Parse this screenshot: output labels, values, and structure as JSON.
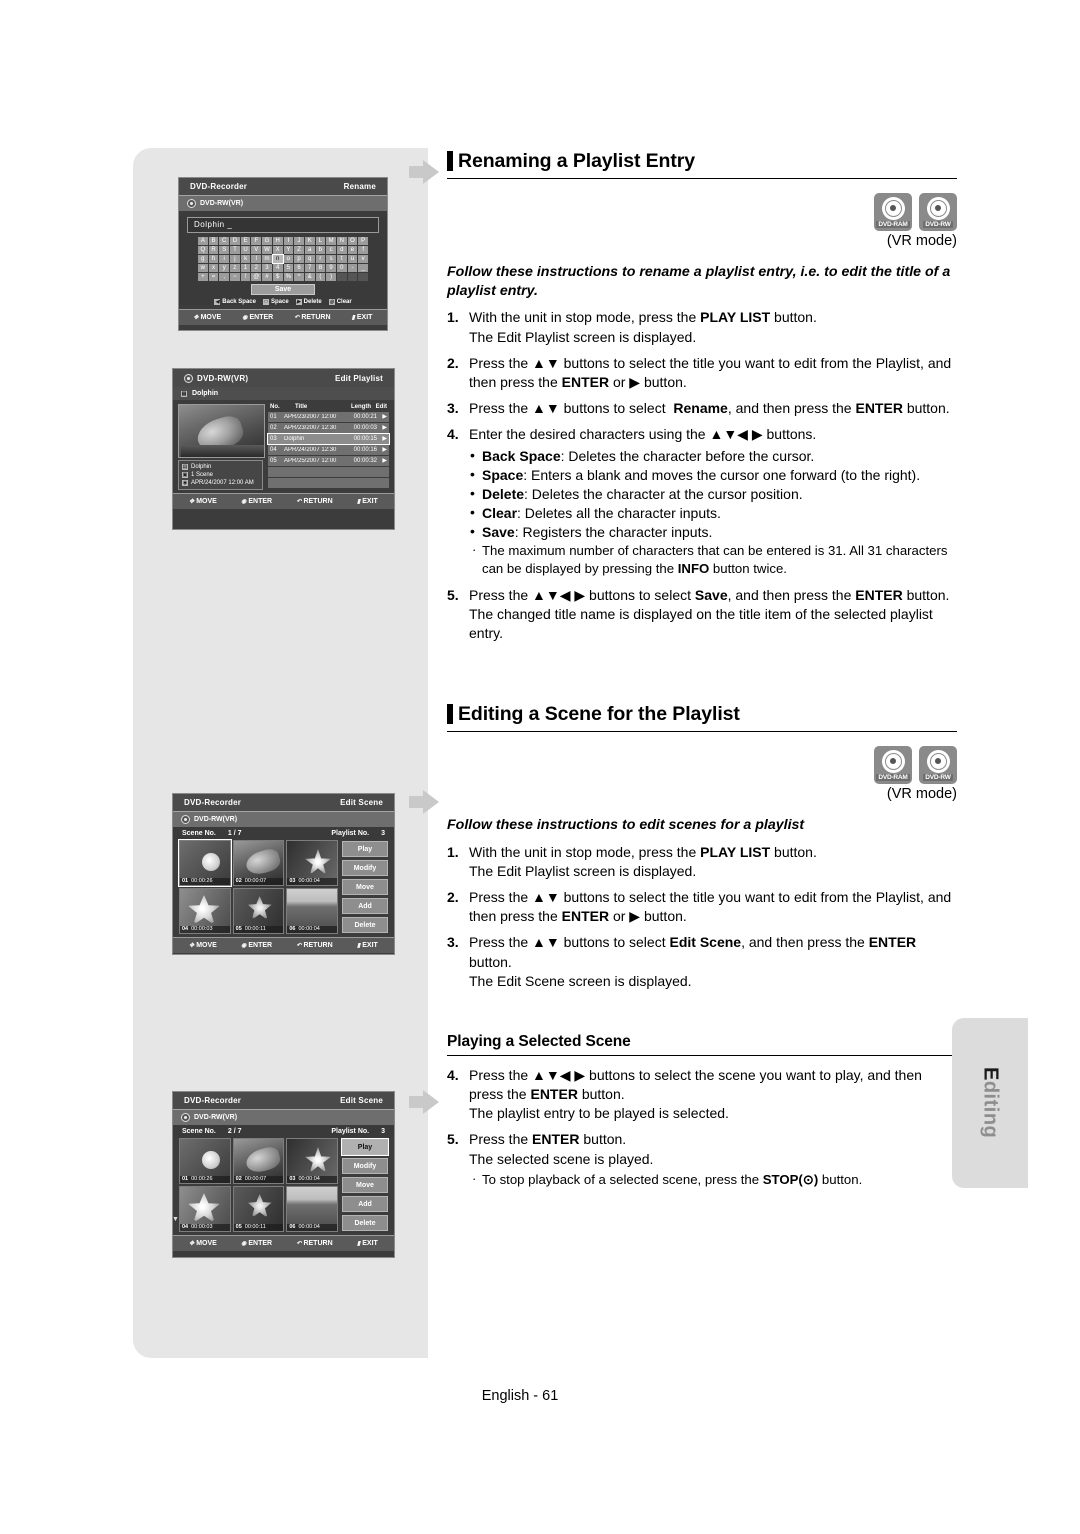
{
  "page": {
    "footer": "English - 61",
    "side_tab": "Editing"
  },
  "sections": [
    {
      "title": "Renaming a Playlist Entry",
      "mode_note": "(VR mode)",
      "disc_icons": [
        "DVD-RAM",
        "DVD-RW"
      ],
      "lead": "Follow these instructions to rename a playlist entry, i.e. to edit the title of a playlist entry.",
      "steps": [
        {
          "num": "1.",
          "text_html": "With the unit in stop mode, press the <b>PLAY LIST</b> button.<br>The Edit Playlist screen is displayed."
        },
        {
          "num": "2.",
          "text_html": "Press the ▲▼ buttons to select the title you want to edit from the Playlist, and then press the <b>ENTER</b> or ▶ button."
        },
        {
          "num": "3.",
          "text_html": "Press the ▲▼ buttons to select &nbsp;<b>Rename</b>, and then press the <b>ENTER</b> button."
        },
        {
          "num": "4.",
          "text_html": "Enter the desired characters using the ▲▼◀ ▶ buttons."
        },
        {
          "num": "5.",
          "text_html": "Press the ▲▼◀ ▶ buttons to select <b>Save</b>, and then press the <b>ENTER</b> button.<br>The changed title name is displayed on the title item of the selected playlist entry."
        }
      ],
      "bullets": [
        {
          "text_html": "<b>Back Space</b>: Deletes the character before the cursor.",
          "small": false
        },
        {
          "text_html": "<b>Space</b>: Enters a blank and moves the cursor one forward (to the right).",
          "small": false
        },
        {
          "text_html": "<b>Delete</b>: Deletes the character at the cursor position.",
          "small": false
        },
        {
          "text_html": "<b>Clear</b>: Deletes all the character inputs.",
          "small": false
        },
        {
          "text_html": "<b>Save</b>: Registers the character inputs.",
          "small": false
        },
        {
          "text_html": "The maximum number of characters that can be entered is 31. All 31 characters can be displayed by pressing the <b>INFO</b> button twice.",
          "small": true
        }
      ]
    },
    {
      "title": "Editing a Scene for the Playlist",
      "mode_note": "(VR mode)",
      "disc_icons": [
        "DVD-RAM",
        "DVD-RW"
      ],
      "lead": "Follow these instructions to edit scenes for a playlist",
      "steps": [
        {
          "num": "1.",
          "text_html": "With the unit in stop mode, press the <b>PLAY LIST</b> button.<br>The Edit Playlist screen is displayed."
        },
        {
          "num": "2.",
          "text_html": "Press the ▲▼ buttons to select the title you want to edit from the Playlist, and then press the <b>ENTER</b> or ▶ button."
        },
        {
          "num": "3.",
          "text_html": "Press the ▲▼ buttons to select <b>Edit Scene</b>, and then press the <b>ENTER</b> button.<br>The Edit Scene screen is displayed."
        }
      ]
    },
    {
      "title": "Playing a Selected Scene",
      "is_sub": true,
      "steps": [
        {
          "num": "4.",
          "text_html": "Press the ▲▼◀ ▶ buttons to select the scene you want to play, and then press the <b>ENTER</b> button.<br>The playlist entry to be played is selected."
        },
        {
          "num": "5.",
          "text_html": "Press the <b>ENTER</b> button.<br>The selected scene is played."
        }
      ],
      "bullets": [
        {
          "text_html": "To stop playback of a selected scene, press the <b>STOP(⊙)</b> button.",
          "small": true
        }
      ]
    }
  ],
  "osd_rename": {
    "title_left": "DVD-Recorder",
    "title_right": "Rename",
    "disc_label": "DVD-RW(VR)",
    "name_value": "Dolphin _",
    "keyboard_rows": [
      [
        "A",
        "B",
        "C",
        "D",
        "E",
        "F",
        "G",
        "H",
        "I",
        "J",
        "K",
        "L",
        "M",
        "N",
        "O",
        "P"
      ],
      [
        "Q",
        "R",
        "S",
        "T",
        "U",
        "V",
        "W",
        "X",
        "Y",
        "Z",
        "a",
        "b",
        "c",
        "d",
        "e",
        "f"
      ],
      [
        "g",
        "h",
        "i",
        "j",
        "k",
        "l",
        "m",
        "n",
        "o",
        "p",
        "q",
        "r",
        "s",
        "t",
        "u",
        "v"
      ],
      [
        "w",
        "x",
        "y",
        "z",
        "1",
        "2",
        "3",
        "4",
        "5",
        "6",
        "7",
        "8",
        "9",
        "0",
        "-",
        "_"
      ],
      [
        "+",
        "=",
        ",",
        "~",
        "!",
        "@",
        "#",
        "$",
        "%",
        "^",
        "&",
        "(",
        ")",
        "",
        "",
        ""
      ]
    ],
    "selected_key": {
      "row": 2,
      "col": 7
    },
    "save_label": "Save",
    "legend": [
      {
        "icon": "◀",
        "label": "Back Space"
      },
      {
        "icon": "□",
        "label": "Space"
      },
      {
        "icon": "▶",
        "label": "Delete"
      },
      {
        "icon": "◎",
        "label": "Clear"
      }
    ],
    "footer": [
      {
        "icon": "✥",
        "label": "MOVE"
      },
      {
        "icon": "◉",
        "label": "ENTER"
      },
      {
        "icon": "↶",
        "label": "RETURN"
      },
      {
        "icon": "▮",
        "label": "EXIT"
      }
    ]
  },
  "osd_playlist": {
    "title_left": "DVD-RW(VR)",
    "title_right": "Edit Playlist",
    "sub_label": "Dolphin",
    "info": {
      "title": "Dolphin",
      "scenes": "1 Scene",
      "date": "APR/24/2007 12:00 AM"
    },
    "columns": [
      "No.",
      "Title",
      "Length",
      "Edit"
    ],
    "rows": [
      {
        "no": "01",
        "title": "APR/23/2007 12:00",
        "length": "00:00:21",
        "edit": "▶",
        "selected": false
      },
      {
        "no": "02",
        "title": "APR/23/2007 12:30",
        "length": "00:00:03",
        "edit": "▶",
        "selected": false
      },
      {
        "no": "03",
        "title": "Dolphin",
        "length": "00:00:15",
        "edit": "▶",
        "selected": true
      },
      {
        "no": "04",
        "title": "APR/24/2007 12:30",
        "length": "00:00:16",
        "edit": "▶",
        "selected": false
      },
      {
        "no": "05",
        "title": "APR/25/2007 12:00",
        "length": "00:00:32",
        "edit": "▶",
        "selected": false
      }
    ],
    "footer": [
      {
        "icon": "✥",
        "label": "MOVE"
      },
      {
        "icon": "◉",
        "label": "ENTER"
      },
      {
        "icon": "↶",
        "label": "RETURN"
      },
      {
        "icon": "▮",
        "label": "EXIT"
      }
    ]
  },
  "osd_scene1": {
    "title_left": "DVD-Recorder",
    "title_right": "Edit Scene",
    "disc_label": "DVD-RW(VR)",
    "scene_no_label": "Scene No.",
    "scene_no_value": "1 / 7",
    "playlist_no_label": "Playlist No.",
    "playlist_no_value": "3",
    "scenes": [
      {
        "no": "01",
        "time": "00:00:26",
        "art": "th-leaf",
        "selected": true
      },
      {
        "no": "02",
        "time": "00:00:07",
        "art": "th-dolphin",
        "selected": false
      },
      {
        "no": "03",
        "time": "00:00:04",
        "art": "th-flower1",
        "selected": false
      },
      {
        "no": "04",
        "time": "00:00:03",
        "art": "th-flower2",
        "selected": false
      },
      {
        "no": "05",
        "time": "00:00:11",
        "art": "th-flower3",
        "selected": false
      },
      {
        "no": "06",
        "time": "00:00:04",
        "art": "th-field",
        "selected": false
      }
    ],
    "buttons": [
      {
        "label": "Play",
        "selected": false
      },
      {
        "label": "Modify",
        "selected": false
      },
      {
        "label": "Move",
        "selected": false
      },
      {
        "label": "Add",
        "selected": false
      },
      {
        "label": "Delete",
        "selected": false
      }
    ],
    "footer": [
      {
        "icon": "✥",
        "label": "MOVE"
      },
      {
        "icon": "◉",
        "label": "ENTER"
      },
      {
        "icon": "↶",
        "label": "RETURN"
      },
      {
        "icon": "▮",
        "label": "EXIT"
      }
    ]
  },
  "osd_scene2": {
    "title_left": "DVD-Recorder",
    "title_right": "Edit Scene",
    "disc_label": "DVD-RW(VR)",
    "scene_no_label": "Scene No.",
    "scene_no_value": "2 / 7",
    "playlist_no_label": "Playlist No.",
    "playlist_no_value": "3",
    "scroll_mark": "▼",
    "scenes": [
      {
        "no": "01",
        "time": "00:00:26",
        "art": "th-leaf",
        "selected": false
      },
      {
        "no": "02",
        "time": "00:00:07",
        "art": "th-dolphin",
        "selected": false
      },
      {
        "no": "03",
        "time": "00:00:04",
        "art": "th-flower1",
        "selected": false
      },
      {
        "no": "04",
        "time": "00:00:03",
        "art": "th-flower2",
        "selected": false
      },
      {
        "no": "05",
        "time": "00:00:11",
        "art": "th-flower3",
        "selected": false
      },
      {
        "no": "06",
        "time": "00:00:04",
        "art": "th-field",
        "selected": false
      }
    ],
    "buttons": [
      {
        "label": "Play",
        "selected": true
      },
      {
        "label": "Modify",
        "selected": false
      },
      {
        "label": "Move",
        "selected": false
      },
      {
        "label": "Add",
        "selected": false
      },
      {
        "label": "Delete",
        "selected": false
      }
    ],
    "footer": [
      {
        "icon": "✥",
        "label": "MOVE"
      },
      {
        "icon": "◉",
        "label": "ENTER"
      },
      {
        "icon": "↶",
        "label": "RETURN"
      },
      {
        "icon": "▮",
        "label": "EXIT"
      }
    ]
  }
}
